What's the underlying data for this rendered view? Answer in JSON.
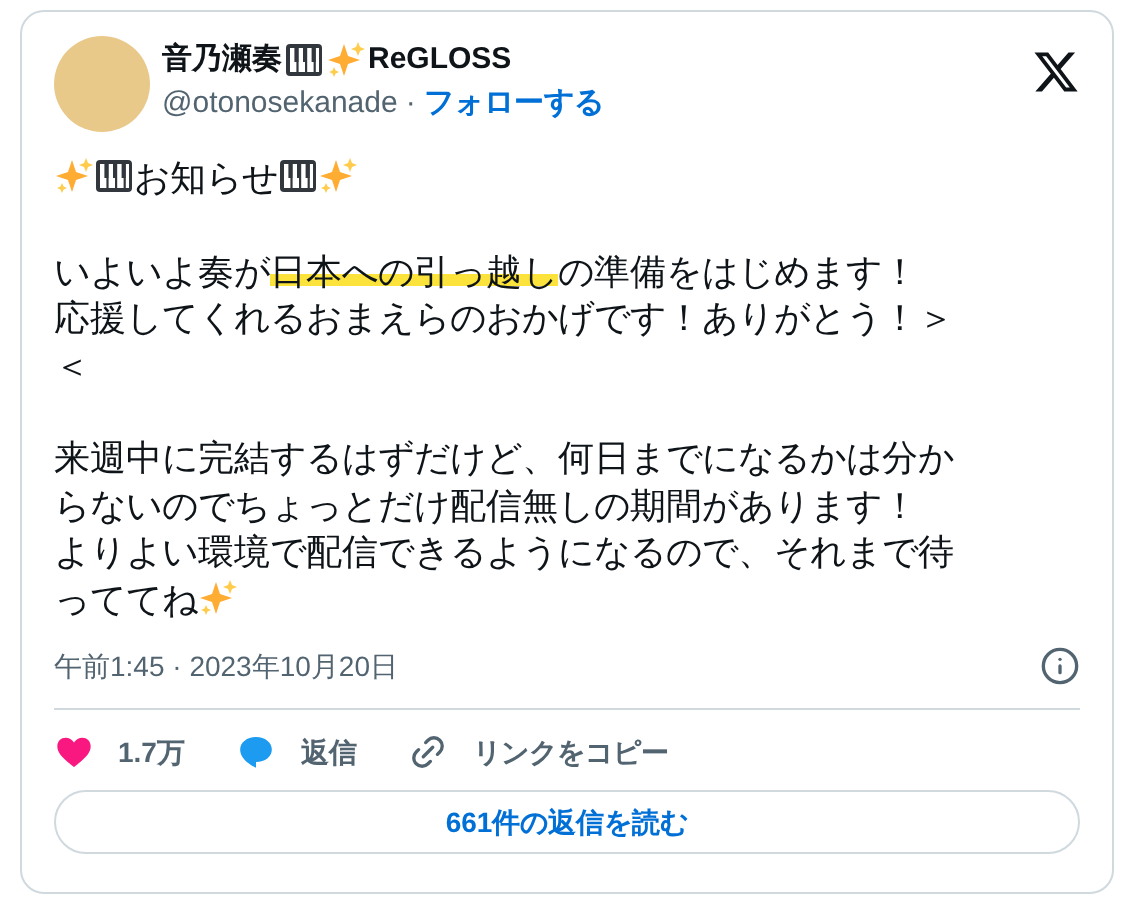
{
  "author": {
    "name": [
      {
        "kind": "text",
        "text": "音乃瀬奏"
      },
      {
        "kind": "piano"
      },
      {
        "kind": "sparkle"
      },
      {
        "kind": "text",
        "text": "ReGLOSS"
      }
    ],
    "handle": "@otonosekanade",
    "separator": "·",
    "follow": "フォローする"
  },
  "paragraphs": [
    {
      "lines": [
        [
          {
            "kind": "sparkle"
          },
          {
            "kind": "piano"
          },
          {
            "kind": "text",
            "text": "お知らせ"
          },
          {
            "kind": "piano"
          },
          {
            "kind": "sparkle"
          }
        ]
      ]
    },
    {
      "lines": [
        [
          {
            "kind": "text",
            "text": "いよいよ奏が"
          },
          {
            "kind": "highlight",
            "text": "日本への引っ越し"
          },
          {
            "kind": "text",
            "text": "の準備をはじめます！"
          }
        ],
        [
          {
            "kind": "text",
            "text": "応援してくれるおまえらのおかげです！ありがとう！＞"
          }
        ],
        [
          {
            "kind": "text",
            "text": "＜"
          }
        ]
      ]
    },
    {
      "lines": [
        [
          {
            "kind": "text",
            "text": "来週中に完結するはずだけど、何日までになるかは分か"
          }
        ],
        [
          {
            "kind": "text",
            "text": "らないのでちょっとだけ配信無しの期間があります！"
          }
        ],
        [
          {
            "kind": "text",
            "text": "よりよい環境で配信できるようになるので、それまで待"
          }
        ],
        [
          {
            "kind": "text",
            "text": "っててね"
          },
          {
            "kind": "sparkle"
          }
        ]
      ]
    }
  ],
  "timestamp": "午前1:45 · 2023年10月20日",
  "actions": [
    {
      "kind": "like",
      "label": "1.7万"
    },
    {
      "kind": "reply",
      "label": "返信"
    },
    {
      "kind": "copy",
      "label": "リンクをコピー"
    }
  ],
  "read_replies": "661件の返信を読む"
}
